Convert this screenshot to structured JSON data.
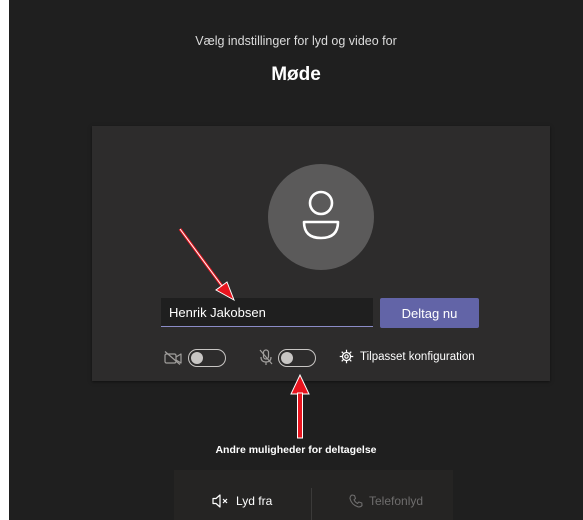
{
  "header": {
    "subtitle": "Vælg indstillinger for lyd og video for",
    "meeting_title": "Møde"
  },
  "join_panel": {
    "name_input_value": "Henrik Jakobsen",
    "join_button_label": "Deltag nu",
    "video_toggle_on": false,
    "mic_toggle_on": false,
    "custom_settings_label": "Tilpasset konfiguration"
  },
  "annotations": {
    "other_options_label": "Andre muligheder for deltagelse",
    "arrow_color": "#e8141e"
  },
  "audio_options": {
    "audio_off_label": "Lyd fra",
    "phone_audio_label": "Telefonlyd"
  },
  "colors": {
    "accent": "#6264a7",
    "background": "#1f1f1f",
    "panel": "#2d2c2c"
  }
}
